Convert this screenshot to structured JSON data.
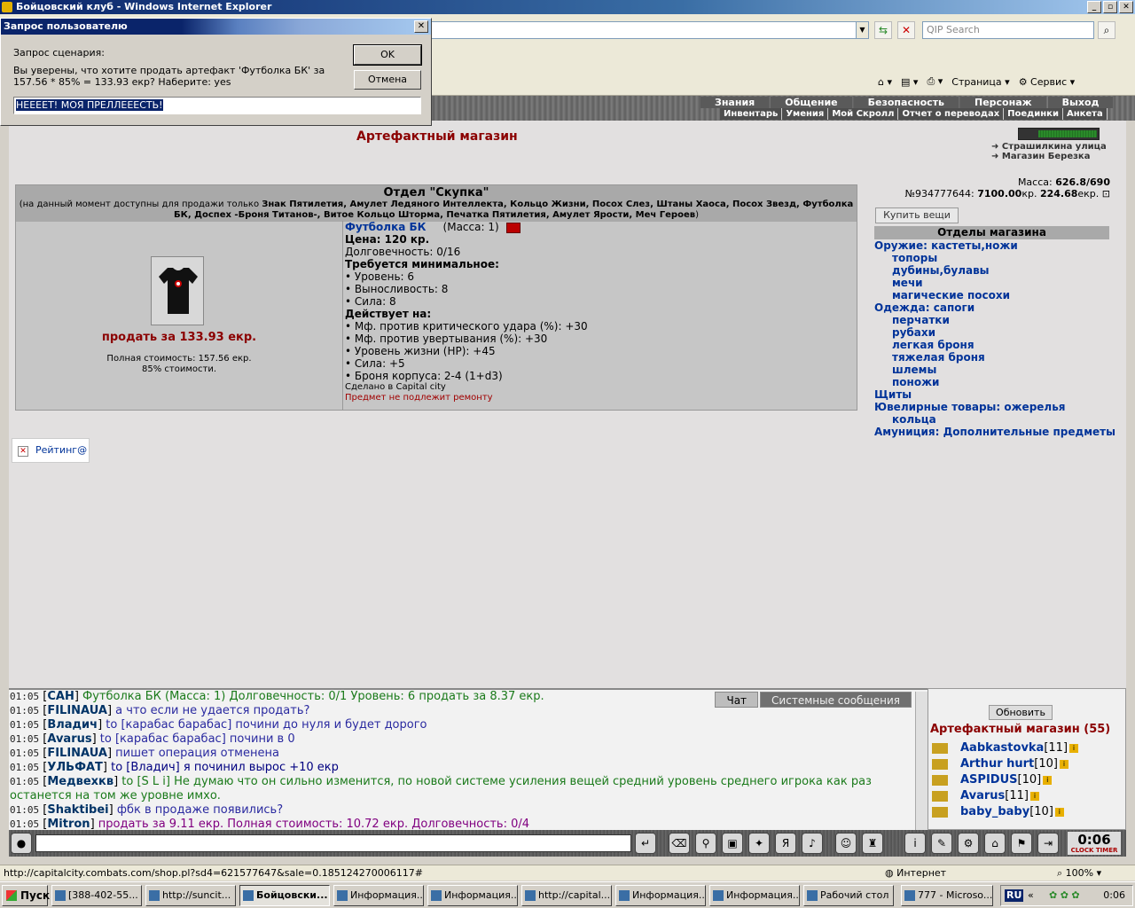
{
  "window": {
    "title": "Бойцовский клуб - Windows Internet Explorer",
    "min": "_",
    "max": "▫",
    "close": "✕"
  },
  "ie": {
    "search_placeholder": "QIP Search",
    "page_menu": "Страница",
    "tools_menu": "Сервис"
  },
  "nav": {
    "row1": [
      "Знания",
      "Общение",
      "Безопасность",
      "Персонаж",
      "Выход"
    ],
    "row2": [
      "Инвентарь",
      "Умения",
      "Мой Скролл",
      "Отчет о переводах",
      "Поединки",
      "Анкета"
    ]
  },
  "page": {
    "title": "Артефактный магазин",
    "locations": [
      "Страшилкина улица",
      "Магазин Березка"
    ],
    "mass_label": "Масса:",
    "mass_value": "626.8/690",
    "account_id": "№934777644:",
    "money_kr": "7100.00",
    "kr_unit": "кр.",
    "money_ekr": "224.68",
    "ekr_unit": "екр.",
    "buy_button": "Купить вещи"
  },
  "departments": {
    "title": "Отделы магазина",
    "items": [
      {
        "label": "Оружие: кастеты,ножи",
        "sub": false
      },
      {
        "label": "топоры",
        "sub": true
      },
      {
        "label": "дубины,булавы",
        "sub": true
      },
      {
        "label": "мечи",
        "sub": true
      },
      {
        "label": "магические посохи",
        "sub": true
      },
      {
        "label": "Одежда: сапоги",
        "sub": false
      },
      {
        "label": "перчатки",
        "sub": true
      },
      {
        "label": "рубахи",
        "sub": true
      },
      {
        "label": "легкая броня",
        "sub": true
      },
      {
        "label": "тяжелая броня",
        "sub": true
      },
      {
        "label": "шлемы",
        "sub": true
      },
      {
        "label": "поножи",
        "sub": true
      },
      {
        "label": "Щиты",
        "sub": false
      },
      {
        "label": "Ювелирные товары: ожерелья",
        "sub": false
      },
      {
        "label": "кольца",
        "sub": true
      },
      {
        "label": "Амуниция: Дополнительные предметы",
        "sub": false
      }
    ]
  },
  "skupka": {
    "title": "Отдел \"Скупка\"",
    "note_prefix": "(на данный момент доступны для продажи только ",
    "note_items": "Знак Пятилетия, Амулет Ледяного Интеллекта, Кольцо Жизни, Посох Слез, Штаны Хаоса, Посох Звезд, Футболка БК, Доспех -Броня Титанов-, Витое Кольцо Шторма, Печатка Пятилетия, Амулет Ярости, Меч Героев",
    "note_suffix": ")",
    "sell_link": "продать за 133.93 екр.",
    "full_cost": "Полная стоимость: 157.56 екр.",
    "percent": "85% стоимости."
  },
  "item": {
    "name": "Футболка БК",
    "mass": "(Масса: 1)",
    "price": "Цена: 120 кр.",
    "durability": "Долговечность: 0/16",
    "req_title": "Требуется минимальное:",
    "reqs": [
      "• Уровень: 6",
      "• Выносливость: 8",
      "• Сила: 8"
    ],
    "eff_title": "Действует на:",
    "effects": [
      "• Мф. против критического удара (%): +30",
      "• Мф. против увертывания (%): +30",
      "• Уровень жизни (HP): +45",
      "• Сила: +5",
      "• Броня корпуса: 2-4 (1+d3)"
    ],
    "made_in": "Сделано в Capital city",
    "no_repair": "Предмет не подлежит ремонту"
  },
  "rating": {
    "label": "Рейтинг@"
  },
  "chat": {
    "tabs": [
      "Чат",
      "Системные сообщения"
    ],
    "lines": [
      {
        "time": "01:05",
        "nick": "САН",
        "text": " Футболка БК (Масса: 1) Долговечность: 0/1 Уровень: 6 продать за 8.37 екр.",
        "cls": "msg-green"
      },
      {
        "time": "01:05",
        "nick": "FILINAUA",
        "text": " а что если не удается продать?",
        "cls": "msg-blue"
      },
      {
        "time": "01:05",
        "nick": "Владич",
        "text": " to [карабас барабас] почини до нуля и будет дорого",
        "cls": "msg-blue"
      },
      {
        "time": "01:05",
        "nick": "Avarus",
        "text": " to [карабас барабас] почини в 0",
        "cls": "msg-blue"
      },
      {
        "time": "01:05",
        "nick": "FILINAUA",
        "text": " пишет операция отменена",
        "cls": "msg-blue"
      },
      {
        "time": "01:05",
        "nick": "УЛЬФАТ",
        "text": " to [Владич] я починил вырос +10 екр",
        "cls": "msg-navy"
      },
      {
        "time": "01:05",
        "nick": "Медвехкв",
        "text": " to [S L i] Не думаю что он сильно изменится, по новой системе усиления вещей средний уровень среднего игрока как раз",
        "cls": "msg-green"
      },
      {
        "time": "",
        "nick": "",
        "text": "останется на том же уровне имхо.",
        "cls": "msg-green"
      },
      {
        "time": "01:05",
        "nick": "Shaktibei",
        "text": " фбк в продаже появились?",
        "cls": "msg-blue"
      },
      {
        "time": "01:05",
        "nick": "Mitron",
        "text": " продать за 9.11 екр. Полная стоимость: 10.72 екр. Долговечность: 0/4",
        "cls": "msg-purple"
      }
    ]
  },
  "online": {
    "refresh": "Обновить",
    "title": "Артефактный магазин (55)",
    "users": [
      {
        "nick": "Aabkastovka",
        "level": "[11]"
      },
      {
        "nick": "Arthur hurt",
        "level": "[10]"
      },
      {
        "nick": "ASPIDUS",
        "level": "[10]"
      },
      {
        "nick": "Avarus",
        "level": "[11]"
      },
      {
        "nick": "baby_baby",
        "level": "[10]"
      }
    ]
  },
  "clock": {
    "time": "0:06",
    "labels": "CLOCK TIMER"
  },
  "status": {
    "url": "http://capitalcity.combats.com/shop.pl?sd4=621577647&sale=0.185124270006117#",
    "zone": "Интернет",
    "zoom": "100%"
  },
  "taskbar": {
    "start": "Пуск",
    "tasks": [
      "[388-402-55...",
      "http://suncit...",
      "Бойцовски...",
      "Информация...",
      "Информация...",
      "http://capital...",
      "Информация...",
      "Информация...",
      "Рабочий стол",
      "777 - Microso..."
    ],
    "lang": "RU",
    "time": "0:06"
  },
  "dialog": {
    "title": "Запрос пользователю",
    "label": "Запрос сценария:",
    "message": "Вы уверены, что хотите продать артефакт 'Футболка БК' за 157.56 * 85% = 133.93 екр? Наберите: yes",
    "ok": "OK",
    "cancel": "Отмена",
    "input_value": "НЕЕЕЕТ! МОЯ ПРЕЛЛЕЕЕСТЬ!"
  }
}
